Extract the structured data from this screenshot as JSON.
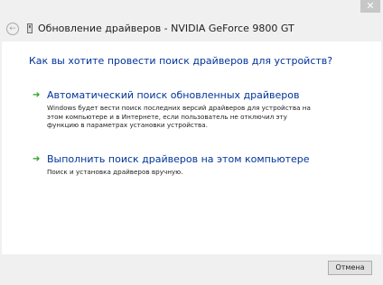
{
  "window": {
    "close_glyph": "✕",
    "title": "Обновление драйверов - NVIDIA GeForce 9800 GT"
  },
  "nav": {
    "back_glyph": "←"
  },
  "content": {
    "question": "Как вы хотите провести поиск драйверов для устройств?",
    "options": [
      {
        "title": "Автоматический поиск обновленных драйверов",
        "description": "Windows будет вести поиск последних версий драйверов для устройства на этом компьютере и в Интернете, если пользователь не отключил эту функцию в параметрах установки устройства.",
        "icon": "green-arrow-icon"
      },
      {
        "title": "Выполнить поиск драйверов на этом компьютере",
        "description": "Поиск и установка драйверов вручную.",
        "icon": "green-arrow-icon"
      }
    ]
  },
  "footer": {
    "cancel_label": "Отмена"
  },
  "colors": {
    "link_blue": "#003399",
    "arrow_green": "#2a9d2a",
    "background": "#f0f0f0",
    "content_bg": "#ffffff"
  }
}
